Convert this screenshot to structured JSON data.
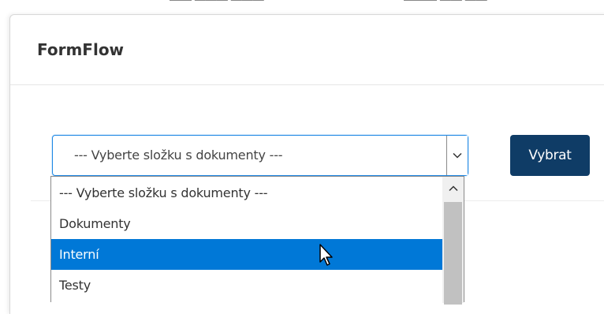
{
  "background_fragments": [
    "—— ——— ———",
    "——— —— ——"
  ],
  "modal": {
    "title": "FormFlow"
  },
  "select": {
    "current_value": "--- Vyberte složku s dokumenty ---",
    "arrow_icon": "chevron-down-icon"
  },
  "button": {
    "label": "Vybrat",
    "color": "#0f3c66"
  },
  "dropdown": {
    "options": [
      "--- Vyberte složku s dokumenty ---",
      "Dokumenty",
      "Interní",
      "Testy"
    ],
    "highlighted_option": "Interní",
    "highlight_color": "#0078d7",
    "scroll_up_icon": "chevron-up-icon"
  },
  "cursor_icon": "mouse-pointer-icon"
}
